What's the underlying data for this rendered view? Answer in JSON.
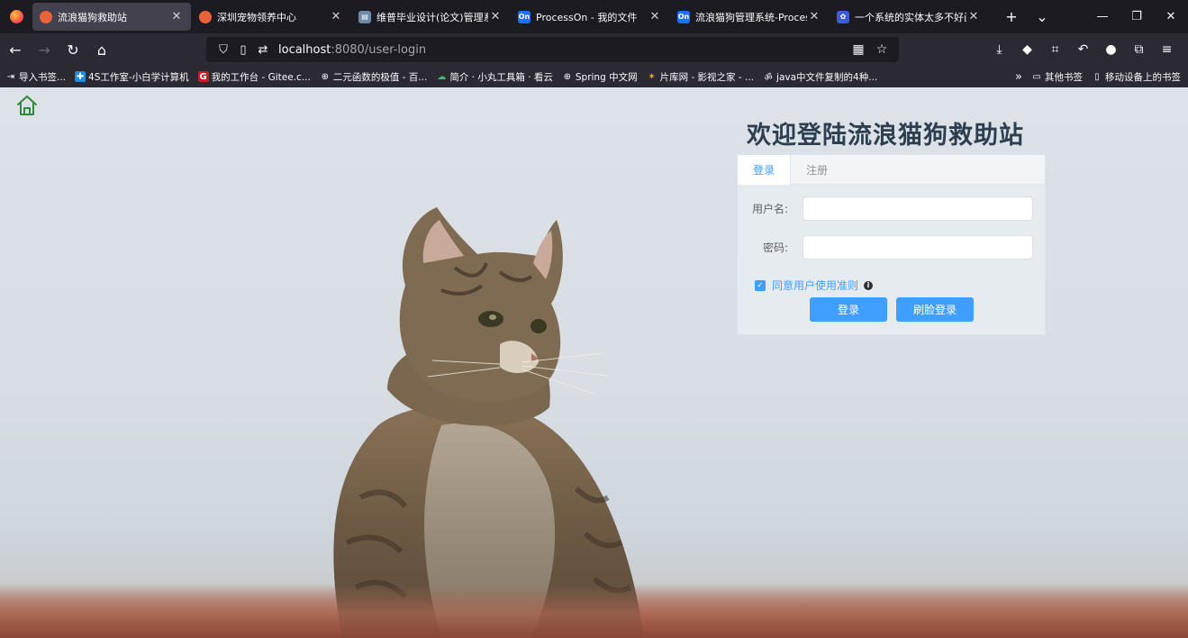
{
  "browser": {
    "tabs": [
      {
        "title": "流浪猫狗救助站",
        "favicon": "orange-circle-icon",
        "active": true
      },
      {
        "title": "深圳宠物领养中心",
        "favicon": "orange-circle-icon",
        "active": false
      },
      {
        "title": "维普毕业设计(论文)管理系统",
        "favicon": "document-icon",
        "active": false
      },
      {
        "title": "ProcessOn - 我的文件",
        "favicon": "processon-icon",
        "active": false
      },
      {
        "title": "流浪猫狗管理系统-ProcessOn",
        "favicon": "processon-icon",
        "active": false
      },
      {
        "title": "一个系统的实体太多不好画",
        "favicon": "baidu-icon",
        "active": false
      }
    ],
    "favicon_labels": {
      "processon": "On"
    },
    "url_host": "localhost",
    "url_rest": ":8080/user-login",
    "bookmarks": [
      {
        "label": "导入书签...",
        "icon": "import-icon"
      },
      {
        "label": "4S工作室-小白学计算机",
        "icon": "studio-icon"
      },
      {
        "label": "我的工作台 - Gitee.c...",
        "icon": "gitee-icon"
      },
      {
        "label": "二元函数的极值 - 百...",
        "icon": "globe-icon"
      },
      {
        "label": "简介 · 小丸工具箱 · 看云",
        "icon": "cloud-icon"
      },
      {
        "label": "Spring 中文网",
        "icon": "globe-icon"
      },
      {
        "label": "片库网 - 影视之家 - ...",
        "icon": "film-icon"
      },
      {
        "label": "java中文件复制的4种...",
        "icon": "om-icon"
      }
    ],
    "bookmarks_right": [
      {
        "label": "其他书签",
        "icon": "folder-icon"
      },
      {
        "label": "移动设备上的书签",
        "icon": "mobile-icon"
      }
    ]
  },
  "page": {
    "title": "欢迎登陆流浪猫狗救助站",
    "tabs": [
      {
        "label": "登录",
        "active": true
      },
      {
        "label": "注册",
        "active": false
      }
    ],
    "form": {
      "username_label": "用户名:",
      "username_value": "",
      "password_label": "密码:",
      "password_value": ""
    },
    "agree_label": "同意用户使用准则",
    "agree_checked": true,
    "login_button": "登录",
    "face_login_button": "刷脸登录"
  },
  "colors": {
    "accent": "#409eff",
    "title": "#2c3e50",
    "home_icon": "#2e8b3a"
  }
}
